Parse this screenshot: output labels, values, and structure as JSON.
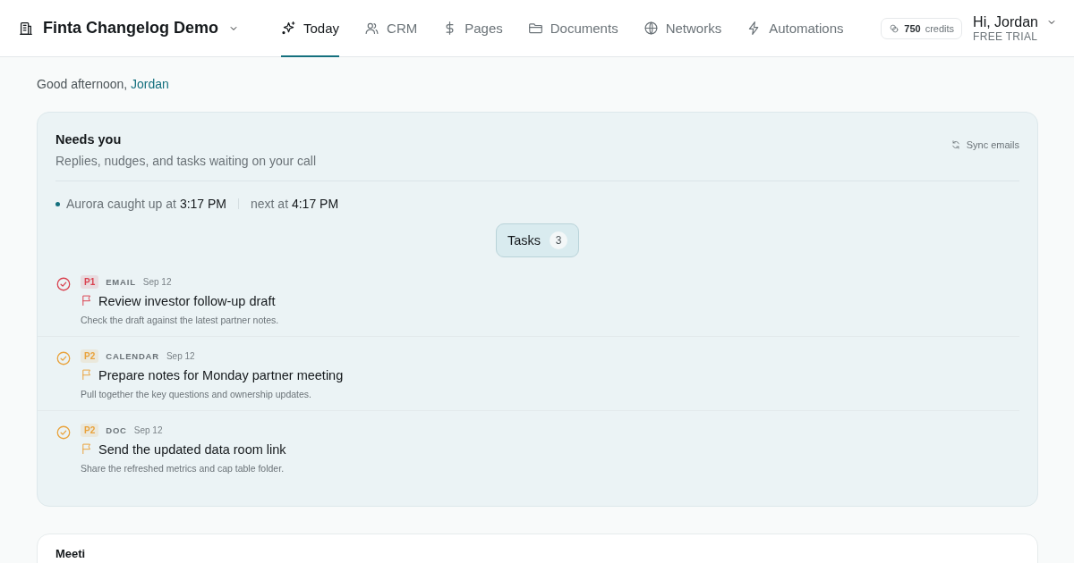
{
  "header": {
    "workspace": "Finta Changelog Demo",
    "nav": [
      {
        "label": "Today",
        "kind": "sparkle",
        "selected": true
      },
      {
        "label": "CRM",
        "kind": "users",
        "selected": false
      },
      {
        "label": "Pages",
        "kind": "dollar",
        "selected": false
      },
      {
        "label": "Documents",
        "kind": "folder",
        "selected": false
      },
      {
        "label": "Networks",
        "kind": "globe",
        "selected": false
      },
      {
        "label": "Automations",
        "kind": "bolt",
        "selected": false
      }
    ],
    "credits": {
      "amount": "750",
      "unit": "credits"
    },
    "user": {
      "greeting": "Hi, Jordan",
      "plan": "FREE TRIAL"
    }
  },
  "greeting": {
    "text": "Good afternoon,",
    "name": "Jordan"
  },
  "needs_you": {
    "title": "Needs you",
    "subtitle": "Replies, nudges, and tasks waiting on your call",
    "sync": "Sync emails",
    "status": {
      "caught_text": "Aurora caught up at",
      "caught_time": "3:17 PM",
      "next_text": "next at",
      "next_time": "4:17 PM"
    },
    "tab": {
      "label": "Tasks",
      "count": "3",
      "selected": true
    },
    "tasks": [
      {
        "priority": "P1",
        "color": "#d9414f",
        "source": "EMAIL",
        "date": "Sep 12",
        "title": "Review investor follow-up draft",
        "note": "Check the draft against the latest partner notes."
      },
      {
        "priority": "P2",
        "color": "#e9a23b",
        "source": "CALENDAR",
        "date": "Sep 12",
        "title": "Prepare notes for Monday partner meeting",
        "note": "Pull together the key questions and ownership updates."
      },
      {
        "priority": "P2",
        "color": "#e9a23b",
        "source": "DOC",
        "date": "Sep 12",
        "title": "Send the updated data room link",
        "note": "Share the refreshed metrics and cap table folder."
      }
    ]
  },
  "next_card": {
    "title": "Meeti"
  }
}
